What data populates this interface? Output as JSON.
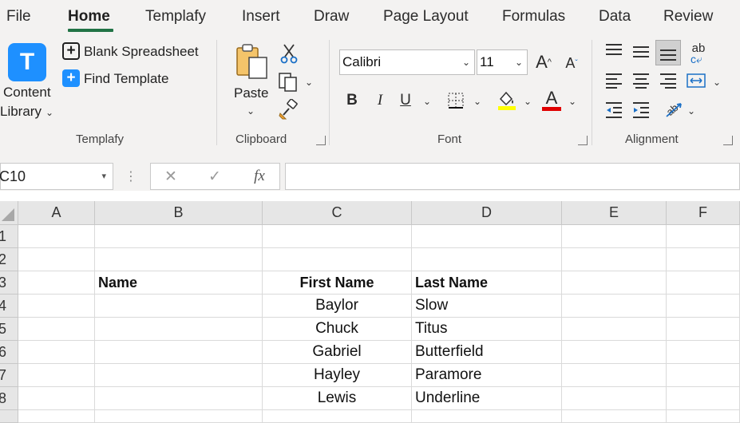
{
  "tabs": [
    {
      "label": "File"
    },
    {
      "label": "Home",
      "active": true
    },
    {
      "label": "Templafy"
    },
    {
      "label": "Insert"
    },
    {
      "label": "Draw"
    },
    {
      "label": "Page Layout"
    },
    {
      "label": "Formulas"
    },
    {
      "label": "Data"
    },
    {
      "label": "Review"
    }
  ],
  "templafy": {
    "logo_letter": "T",
    "content_library_line1": "Content",
    "content_library_line2": "Library",
    "blank_spreadsheet": "Blank Spreadsheet",
    "find_template": "Find Template",
    "group_label": "Templafy"
  },
  "clipboard": {
    "paste_label": "Paste",
    "group_label": "Clipboard"
  },
  "font": {
    "family": "Calibri",
    "size": "11",
    "bold": "B",
    "italic": "I",
    "underline": "U",
    "grow": "A",
    "shrink": "A",
    "color_letter": "A",
    "group_label": "Font",
    "highlight_color": "#ffff00",
    "font_color": "#e00000"
  },
  "alignment": {
    "wrap_label": "ab",
    "group_label": "Alignment"
  },
  "formula_bar": {
    "name_box": "C10",
    "cancel_symbol": "✕",
    "enter_symbol": "✓",
    "fx_symbol": "fx",
    "formula": ""
  },
  "grid": {
    "columns": [
      "A",
      "B",
      "C",
      "D",
      "E",
      "F"
    ],
    "rows": [
      "1",
      "2",
      "3",
      "4",
      "5",
      "6",
      "7",
      "8"
    ],
    "headers": {
      "b": "Name",
      "c": "First Name",
      "d": "Last Name"
    },
    "records": [
      {
        "first": "Baylor",
        "last": "Slow"
      },
      {
        "first": "Chuck",
        "last": "Titus"
      },
      {
        "first": "Gabriel",
        "last": "Butterfield"
      },
      {
        "first": "Hayley",
        "last": "Paramore"
      },
      {
        "first": "Lewis",
        "last": "Underline"
      }
    ]
  },
  "colors": {
    "accent_green": "#217346",
    "templafy_blue": "#1e90ff"
  }
}
